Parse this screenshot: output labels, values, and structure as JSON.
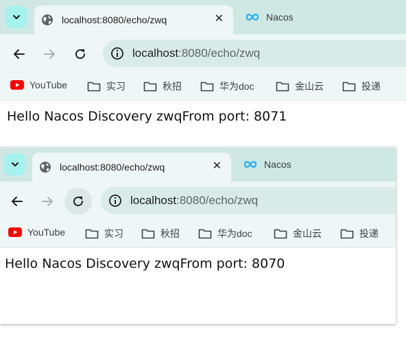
{
  "windows": [
    {
      "tab_active_title": "localhost:8080/echo/zwq",
      "tab_inactive_title": "Nacos",
      "url_host": "localhost",
      "url_rest": ":8080/echo/zwq",
      "bookmarks": [
        {
          "label": "YouTube",
          "icon": "youtube-icon"
        },
        {
          "label": "实习",
          "icon": "folder-icon"
        },
        {
          "label": "秋招",
          "icon": "folder-icon"
        },
        {
          "label": "华为doc",
          "icon": "folder-icon"
        },
        {
          "label": "金山云",
          "icon": "folder-icon"
        },
        {
          "label": "投递",
          "icon": "folder-icon"
        }
      ],
      "body_text": "Hello Nacos Discovery zwqFrom port: 8071"
    },
    {
      "tab_active_title": "localhost:8080/echo/zwq",
      "tab_inactive_title": "Nacos",
      "url_host": "localhost",
      "url_rest": ":8080/echo/zwq",
      "bookmarks": [
        {
          "label": "YouTube",
          "icon": "youtube-icon"
        },
        {
          "label": "实习",
          "icon": "folder-icon"
        },
        {
          "label": "秋招",
          "icon": "folder-icon"
        },
        {
          "label": "华为doc",
          "icon": "folder-icon"
        },
        {
          "label": "金山云",
          "icon": "folder-icon"
        },
        {
          "label": "投递",
          "icon": "folder-icon"
        }
      ],
      "body_text": "Hello Nacos Discovery zwqFrom port: 8070"
    }
  ],
  "colors": {
    "tabbar": "#cfe8e4",
    "toolbar": "#eef7f5",
    "omnibox": "#d9ebe8",
    "youtube_red": "#ff0000",
    "nacos_blue": "#2eb0f0"
  }
}
